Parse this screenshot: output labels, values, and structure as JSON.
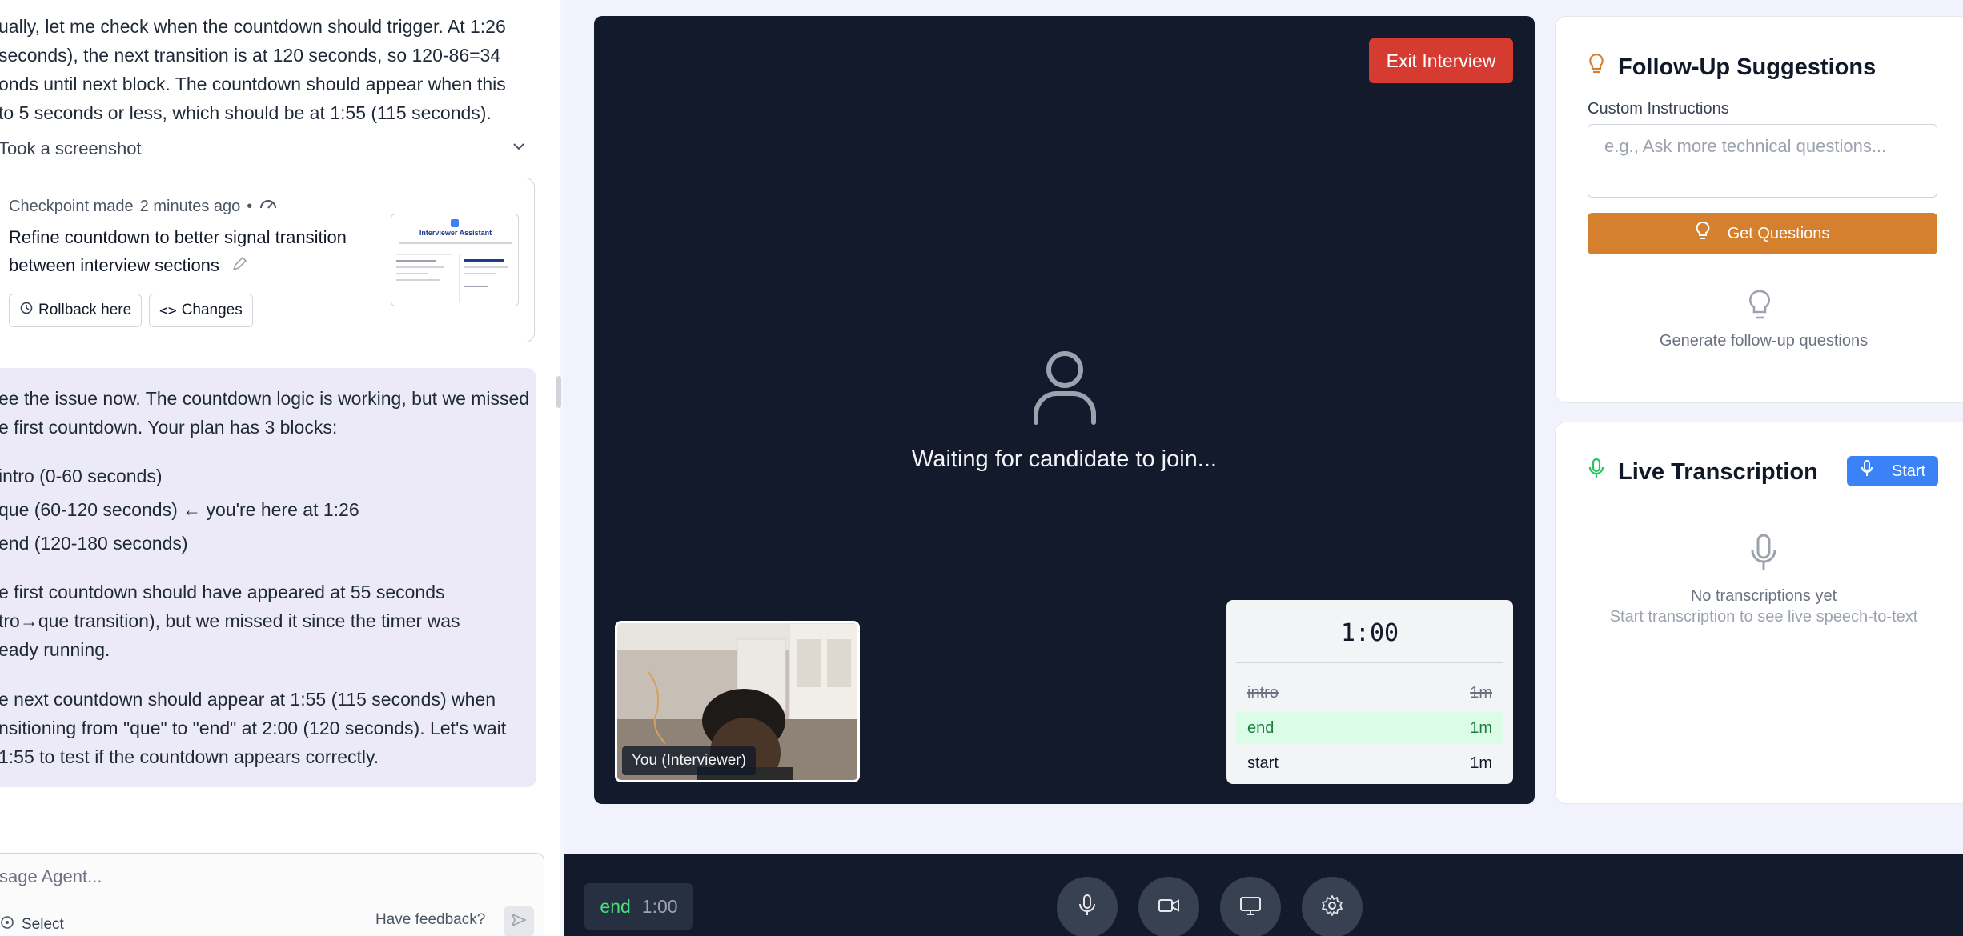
{
  "agent": {
    "intro_lines": [
      "ually, let me check when the countdown should trigger. At 1:26",
      "seconds), the next transition is at 120 seconds, so 120-86=34",
      "onds until next block. The countdown should appear when this",
      "to 5 seconds or less, which should be at 1:55 (115 seconds)."
    ],
    "screenshot_label": "Took a screenshot",
    "checkpoint": {
      "made_label": "Checkpoint made",
      "time_ago": "2 minutes ago",
      "separator": "•",
      "title": "Refine countdown to better signal transition between interview sections",
      "rollback_label": "Rollback here",
      "changes_label": "Changes",
      "thumb_title": "Interviewer Assistant"
    },
    "message": {
      "para1": [
        "ee the issue now. The countdown logic is working, but we missed",
        "e first countdown. Your plan has 3 blocks:"
      ],
      "blocks": [
        "intro (0-60 seconds)",
        "que (60-120 seconds) ← you're here at 1:26",
        "end (120-180 seconds)"
      ],
      "para2": [
        "e first countdown should have appeared at 55 seconds",
        "tro→que transition), but we missed it since the timer was",
        "eady running."
      ],
      "para3": [
        "e next countdown should appear at 1:55 (115 seconds) when",
        "nsitioning from \"que\" to \"end\" at 2:00 (120 seconds). Let's wait",
        "1:55 to test if the countdown appears correctly."
      ]
    },
    "input_placeholder": "sage Agent...",
    "select_label": "Select",
    "feedback_label": "Have feedback?"
  },
  "video": {
    "exit_label": "Exit Interview",
    "waiting_text": "Waiting for candidate to join...",
    "self_label": "You (Interviewer)"
  },
  "timer": {
    "time": "1:00",
    "blocks": [
      {
        "name": "intro",
        "duration": "1m",
        "state": "done"
      },
      {
        "name": "end",
        "duration": "1m",
        "state": "active"
      },
      {
        "name": "start",
        "duration": "1m",
        "state": "pending"
      }
    ]
  },
  "followup": {
    "title": "Follow-Up Suggestions",
    "custom_label": "Custom Instructions",
    "custom_placeholder": "e.g., Ask more technical questions...",
    "button_label": "Get Questions",
    "empty_text": "Generate follow-up questions"
  },
  "transcription": {
    "title": "Live Transcription",
    "start_label": "Start",
    "empty_title": "No transcriptions yet",
    "empty_sub": "Start transcription to see live speech-to-text"
  },
  "controls": {
    "phase_name": "end",
    "phase_time": "1:00",
    "buttons": [
      "mic-icon",
      "camera-icon",
      "screen-share-icon",
      "settings-icon"
    ]
  },
  "colors": {
    "exit": "#d63b32",
    "accent_orange": "#d4802e",
    "accent_blue": "#3b82f6",
    "active_green": "#15803d",
    "stage_bg": "#131a2b"
  }
}
